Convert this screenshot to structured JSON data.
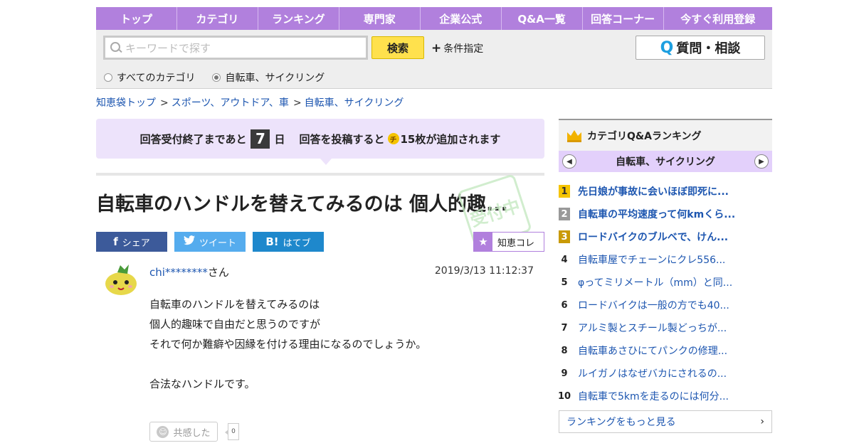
{
  "nav": [
    "トップ",
    "カテゴリ",
    "ランキング",
    "専門家",
    "企業公式",
    "Q&A一覧",
    "回答コーナー",
    "今すぐ利用登録"
  ],
  "search": {
    "placeholder": "キーワードで探す",
    "button": "検索",
    "condition": "条件指定",
    "ask_button": "質問・相談",
    "ask_q": "Q"
  },
  "scope": [
    {
      "label": "すべてのカテゴリ",
      "selected": false
    },
    {
      "label": "自転車、サイクリング",
      "selected": true
    }
  ],
  "breadcrumb": [
    "知恵袋トップ",
    "スポーツ、アウトドア、車",
    "自転車、サイクリング"
  ],
  "notice": {
    "before": "回答受付終了まであと",
    "days": "7",
    "unit": "日",
    "middle": "回答を投稿すると",
    "coin": "チ",
    "after": "15枚が追加されます"
  },
  "question": {
    "title": "自転車のハンドルを替えてみるのは 個人的趣...",
    "stamp": "受付中",
    "user": "chi********",
    "user_suffix": "さん",
    "date": "2019/3/13  11:12:37",
    "body": [
      "自転車のハンドルを替えてみるのは",
      "個人的趣味で自由だと思うのですが",
      "それで何か難癖や因縁を付ける理由になるのでしょうか。",
      "",
      "合法なハンドルです。"
    ],
    "empathy_label": "共感した",
    "empathy_count": "0"
  },
  "share": {
    "facebook": "シェア",
    "twitter": "ツイート",
    "hatena": "はてブ",
    "hatena_icon": "B!",
    "collect": "知恵コレ"
  },
  "ranking": {
    "title": "カテゴリQ&Aランキング",
    "category": "自転車、サイクリング",
    "items": [
      {
        "rank": "1",
        "text": "先日娘が事故に会いほぼ即死に..."
      },
      {
        "rank": "2",
        "text": "自転車の平均速度って何kmくら..."
      },
      {
        "rank": "3",
        "text": "ロードバイクのブルベで、けん..."
      },
      {
        "rank": "4",
        "text": "自転車屋でチェーンにクレ556..."
      },
      {
        "rank": "5",
        "text": "φってミリメートル（mm）と同..."
      },
      {
        "rank": "6",
        "text": "ロードバイクは一般の方でも40..."
      },
      {
        "rank": "7",
        "text": "アルミ製とスチール製どっちが..."
      },
      {
        "rank": "8",
        "text": "自転車あさひにてパンクの修理..."
      },
      {
        "rank": "9",
        "text": "ルイガノはなぜバカにされるの..."
      },
      {
        "rank": "10",
        "text": "自転車で5kmを走るのには何分..."
      }
    ],
    "more": "ランキングをもっと見る"
  },
  "colors": {
    "accent": "#b180dd",
    "search_button": "#ffe14d",
    "notice_bg": "#ede3fb",
    "link": "#1d56b0"
  }
}
